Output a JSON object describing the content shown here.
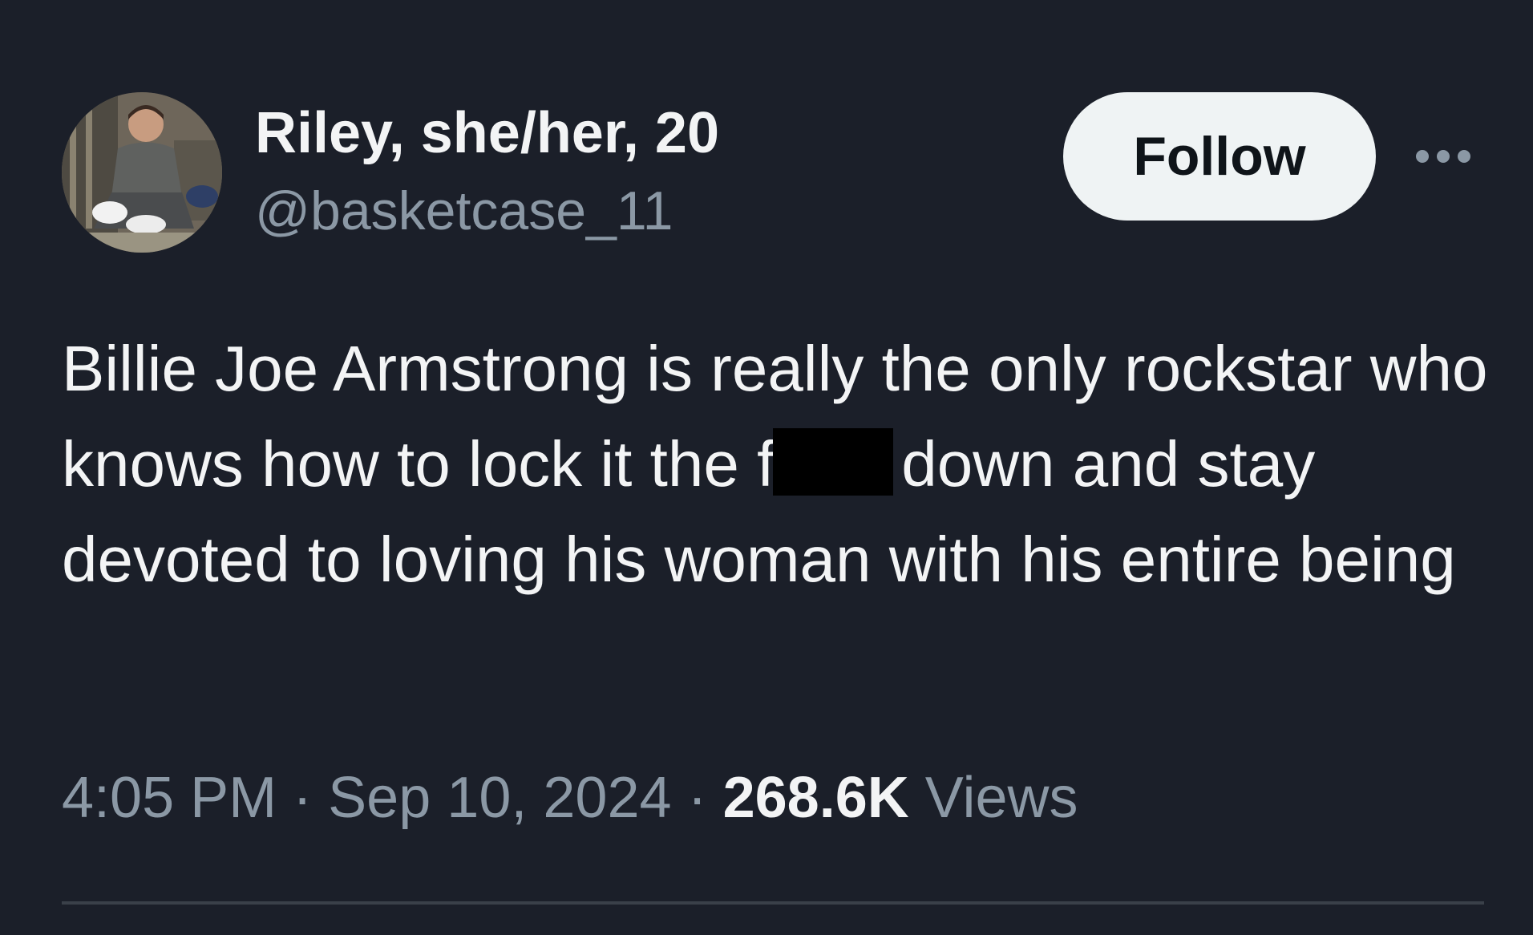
{
  "author": {
    "name": "Riley, she/her, 20",
    "handle": "@basketcase_11"
  },
  "actions": {
    "follow_label": "Follow"
  },
  "icons": {
    "more": "more-horizontal-icon"
  },
  "tweet": {
    "text_before_redaction": "Billie Joe Armstrong is really the only rockstar who knows how to lock it the f",
    "text_after_redaction": "down and stay devoted to loving his woman with his entire being"
  },
  "meta": {
    "time": "4:05 PM",
    "separator": "·",
    "date": "Sep 10, 2024",
    "views_count": "268.6K",
    "views_label": "Views"
  },
  "colors": {
    "background": "#1b1f29",
    "text": "#f3f4f5",
    "secondary_text": "#8b98a5",
    "follow_button_bg": "#eff3f4",
    "redaction": "#000000"
  }
}
